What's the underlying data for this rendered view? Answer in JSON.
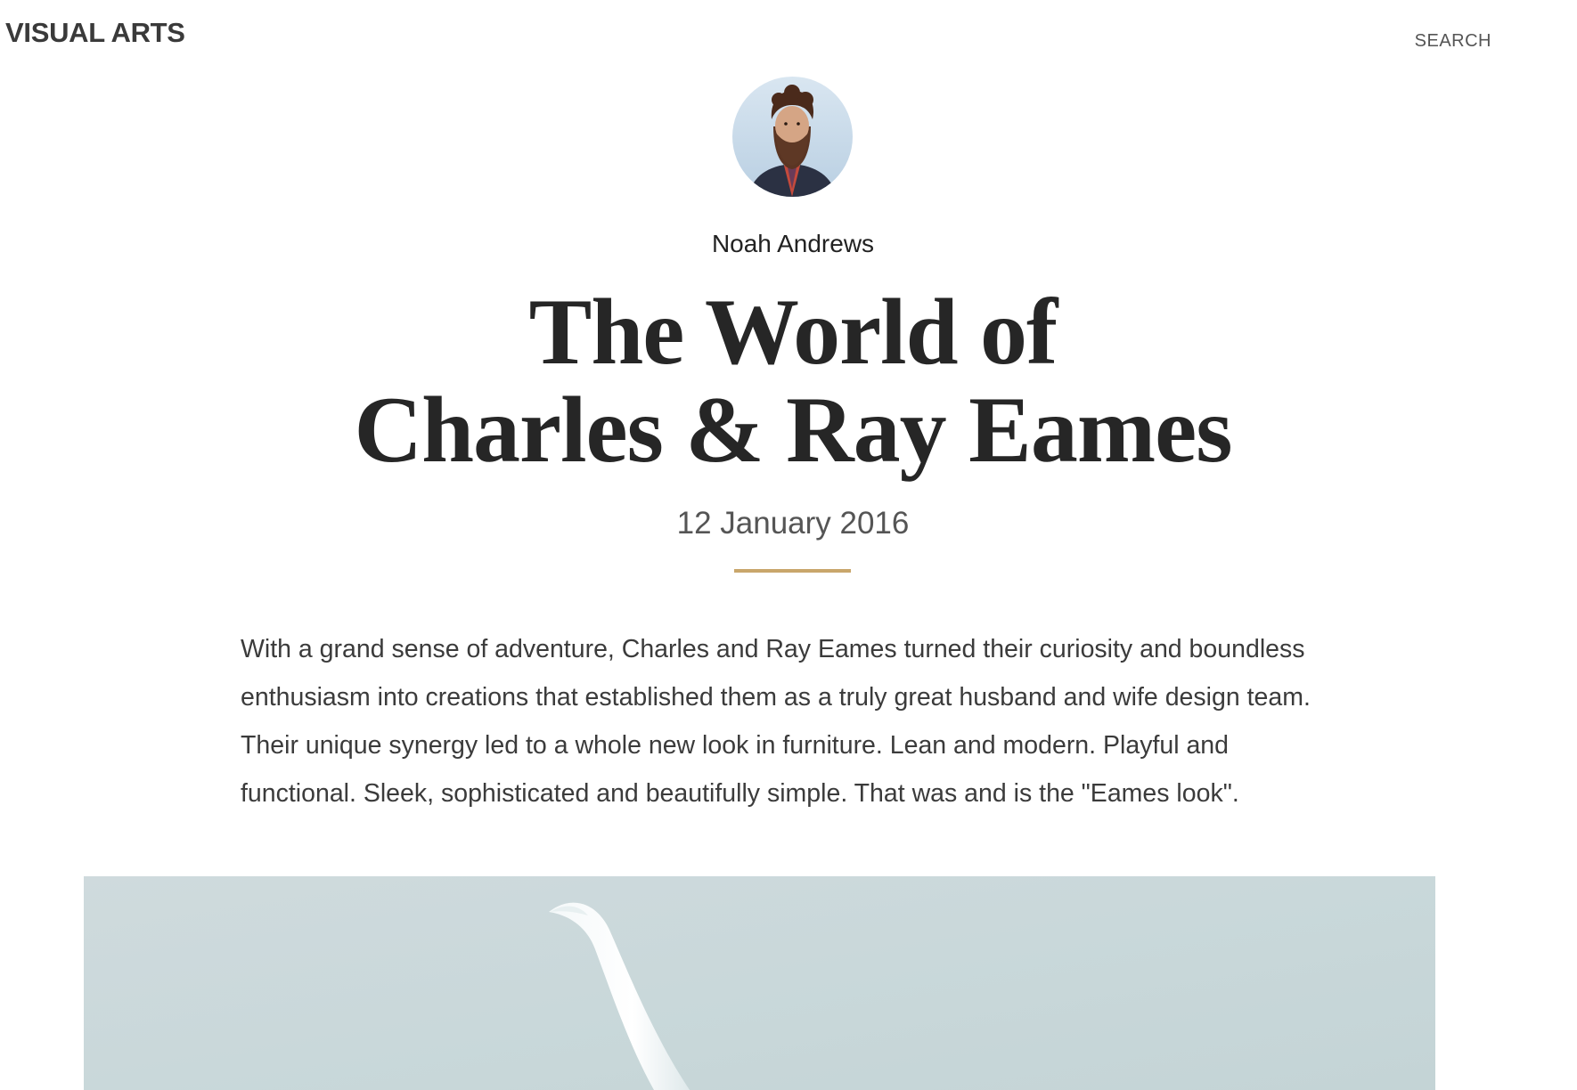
{
  "header": {
    "logo": "VISUAL ARTS",
    "search_label": "SEARCH"
  },
  "article": {
    "author": "Noah Andrews",
    "title_line1": "The World of",
    "title_line2": "Charles & Ray Eames",
    "date": "12 January 2016",
    "intro": "With a grand sense of adventure, Charles and Ray Eames turned their curiosity and boundless enthusiasm into creations that established them as a truly great husband and wife design team. Their unique synergy led to a whole new look in furniture. Lean and modern. Playful and functional. Sleek, sophisticated and beautifully simple. That was and is the \"Eames look\"."
  },
  "colors": {
    "divider_accent": "#c9a66b",
    "hero_background": "#cbd8da",
    "text": "#333333"
  },
  "icons": {
    "avatar": "author-avatar-photo",
    "hero": "hero-image-chair"
  }
}
